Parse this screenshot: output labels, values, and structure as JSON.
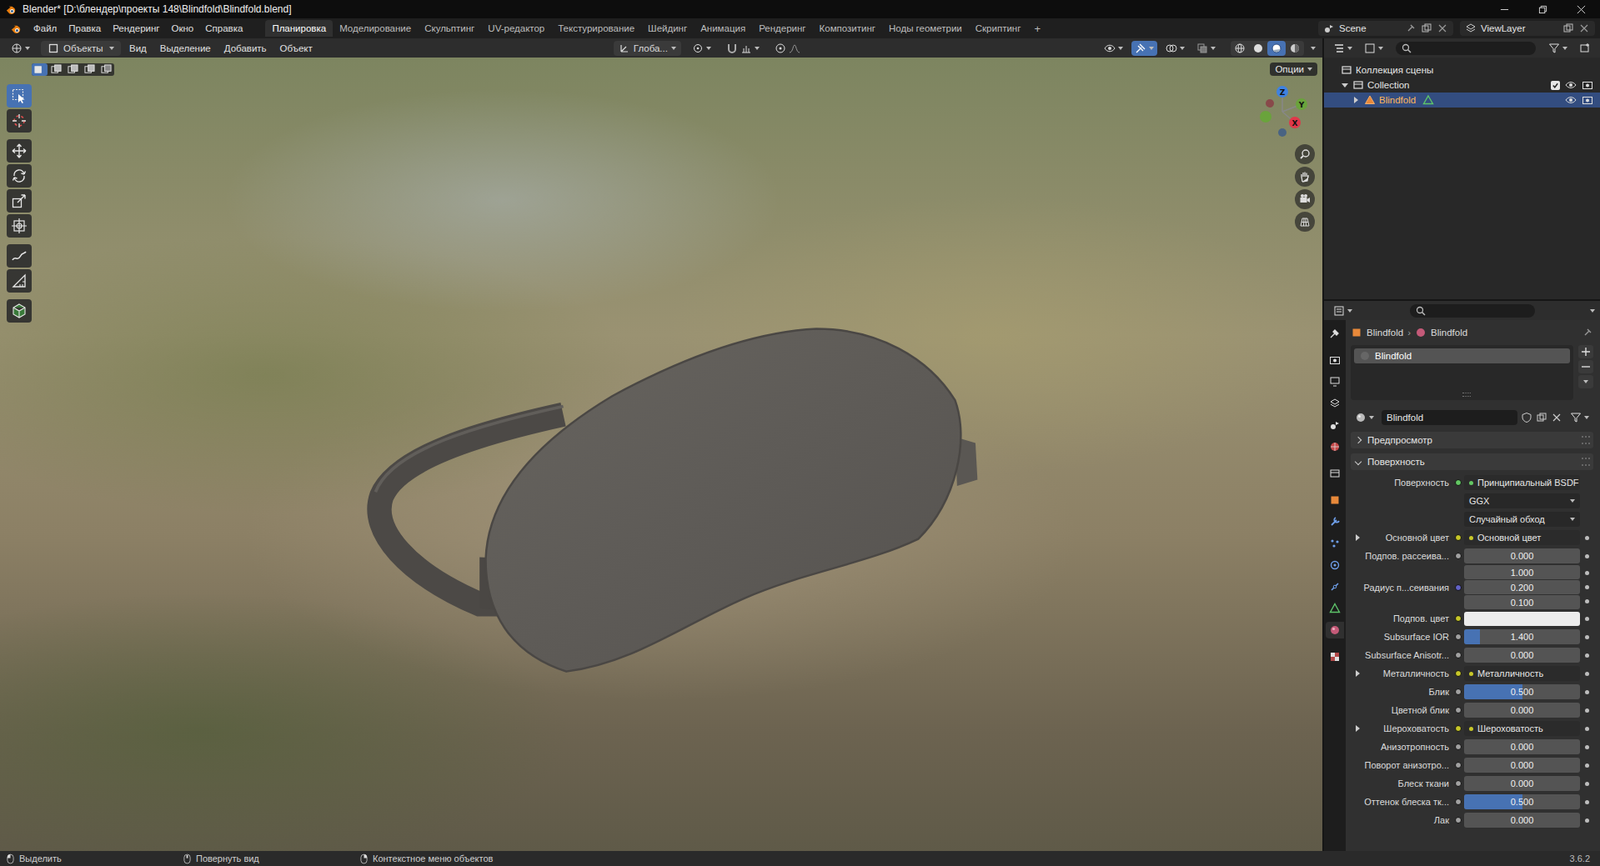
{
  "window": {
    "title": "Blender* [D:\\блендер\\проекты 148\\Blindfold\\Blindfold.blend]"
  },
  "menu": [
    "Файл",
    "Правка",
    "Рендеринг",
    "Окно",
    "Справка"
  ],
  "workspaces": [
    {
      "label": "Планировка",
      "selected": true
    },
    {
      "label": "Моделирование",
      "selected": false
    },
    {
      "label": "Скульптинг",
      "selected": false
    },
    {
      "label": "UV-редактор",
      "selected": false
    },
    {
      "label": "Текстурирование",
      "selected": false
    },
    {
      "label": "Шейдинг",
      "selected": false
    },
    {
      "label": "Анимация",
      "selected": false
    },
    {
      "label": "Рендеринг",
      "selected": false
    },
    {
      "label": "Композитинг",
      "selected": false
    },
    {
      "label": "Ноды геометрии",
      "selected": false
    },
    {
      "label": "Скриптинг",
      "selected": false
    }
  ],
  "add_workspace": "+",
  "scene": "Scene",
  "view_layer": "ViewLayer",
  "viewport": {
    "mode": "Объекты",
    "menus": [
      "Вид",
      "Выделение",
      "Добавить",
      "Объект"
    ],
    "orientation": "Глоба...",
    "options": "Опции",
    "select_modes": [
      {
        "kind": "new",
        "selected": true
      },
      {
        "kind": "extend",
        "selected": false
      },
      {
        "kind": "subtract",
        "selected": false
      },
      {
        "kind": "invert",
        "selected": false
      },
      {
        "kind": "intersect",
        "selected": false
      }
    ],
    "tools": [
      {
        "kind": "select",
        "selected": true
      },
      {
        "kind": "cursor",
        "selected": false
      },
      {
        "kind": "move",
        "selected": false
      },
      {
        "kind": "rotate",
        "selected": false
      },
      {
        "kind": "scale",
        "selected": false
      },
      {
        "kind": "transform",
        "selected": false
      },
      {
        "kind": "annotate",
        "selected": false
      },
      {
        "kind": "measure",
        "selected": false
      },
      {
        "kind": "add-cube",
        "selected": false
      }
    ],
    "toggles": [
      {
        "kind": "visibility",
        "on": false
      },
      {
        "kind": "gizmo",
        "on": true
      },
      {
        "kind": "overlay",
        "on": false
      },
      {
        "kind": "xray",
        "on": false
      }
    ],
    "shading": [
      {
        "kind": "wireframe",
        "selected": false
      },
      {
        "kind": "solid",
        "selected": false
      },
      {
        "kind": "material",
        "selected": true
      },
      {
        "kind": "rendered",
        "selected": false
      }
    ],
    "gizmo": {
      "x": "X",
      "y": "Y",
      "z": "Z"
    }
  },
  "outliner": {
    "rows": [
      {
        "label": "Коллекция сцены",
        "kind": "scene-collection",
        "depth": 0,
        "selected": false
      },
      {
        "label": "Collection",
        "kind": "collection",
        "depth": 1,
        "expanded": true,
        "selected": false,
        "checked": true,
        "visible": true,
        "renderable": true
      },
      {
        "label": "Blindfold",
        "kind": "object",
        "depth": 2,
        "expanded": false,
        "selected": true,
        "visible": true,
        "renderable": true
      }
    ]
  },
  "properties": {
    "tabs": [
      {
        "kind": "tool",
        "selected": false
      },
      {
        "kind": "render",
        "selected": false
      },
      {
        "kind": "output",
        "selected": false
      },
      {
        "kind": "view-layer",
        "selected": false
      },
      {
        "kind": "scene",
        "selected": false
      },
      {
        "kind": "world",
        "selected": false
      },
      {
        "kind": "collection",
        "selected": false
      },
      {
        "kind": "object",
        "selected": false
      },
      {
        "kind": "modifiers",
        "selected": false
      },
      {
        "kind": "particles",
        "selected": false
      },
      {
        "kind": "physics",
        "selected": false
      },
      {
        "kind": "constraints",
        "selected": false
      },
      {
        "kind": "data",
        "selected": false
      },
      {
        "kind": "material",
        "selected": true
      },
      {
        "kind": "texture",
        "selected": false
      }
    ],
    "breadcrumb": [
      "Blindfold",
      "Blindfold"
    ],
    "separator": "›",
    "slots": [
      {
        "label": "Blindfold",
        "selected": true
      }
    ],
    "material": "Blindfold",
    "sections": [
      {
        "label": "Предпросмотр",
        "expanded": false
      },
      {
        "label": "Поверхность",
        "expanded": true
      }
    ],
    "rows": [
      {
        "kind": "shader",
        "label": "Поверхность",
        "value": "Принципиальный BSDF"
      },
      {
        "kind": "dropdown",
        "value": "GGX"
      },
      {
        "kind": "dropdown",
        "value": "Случайный обход"
      },
      {
        "kind": "linked",
        "label": "Основной цвет",
        "value": "Основной цвет",
        "expanded": false
      },
      {
        "kind": "slider",
        "label": "Подпов. рассеива...",
        "value": "0.000",
        "level": 0
      },
      {
        "kind": "vector",
        "label": "Радиус п...сеивания",
        "values": [
          "1.000",
          "0.200",
          "0.100"
        ]
      },
      {
        "kind": "color",
        "label": "Подпов. цвет",
        "color": "#ececec"
      },
      {
        "kind": "slider",
        "label": "Subsurface IOR",
        "value": "1.400",
        "level": 0.14
      },
      {
        "kind": "slider",
        "label": "Subsurface Anisotr...",
        "value": "0.000",
        "level": 0
      },
      {
        "kind": "linked",
        "label": "Металличность",
        "value": "Металличность",
        "expanded": false
      },
      {
        "kind": "slider",
        "label": "Блик",
        "value": "0.500",
        "level": 0.5
      },
      {
        "kind": "slider",
        "label": "Цветной блик",
        "value": "0.000",
        "level": 0
      },
      {
        "kind": "linked",
        "label": "Шероховатость",
        "value": "Шероховатость",
        "expanded": false
      },
      {
        "kind": "slider",
        "label": "Анизотропность",
        "value": "0.000",
        "level": 0
      },
      {
        "kind": "slider",
        "label": "Поворот анизотро...",
        "value": "0.000",
        "level": 0
      },
      {
        "kind": "slider",
        "label": "Блеск ткани",
        "value": "0.000",
        "level": 0
      },
      {
        "kind": "slider",
        "label": "Оттенок блеска тк...",
        "value": "0.500",
        "level": 0.5
      },
      {
        "kind": "slider",
        "label": "Лак",
        "value": "0.000",
        "level": 0
      }
    ]
  },
  "status_bar": {
    "items": [
      "Выделить",
      "Повернуть вид",
      "Контекстное меню объектов"
    ],
    "version": "3.6.2"
  }
}
